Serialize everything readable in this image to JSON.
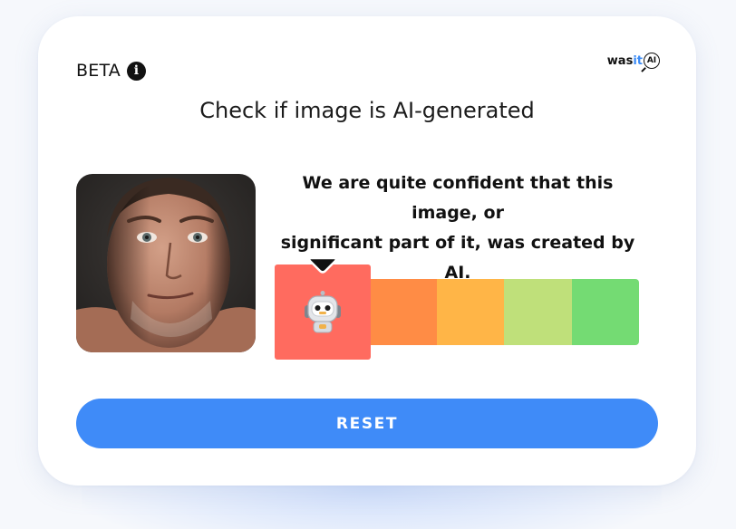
{
  "header": {
    "beta_label": "BETA",
    "info_icon": "info-icon",
    "logo": {
      "prefix": "was",
      "highlight": "it",
      "badge": "AI"
    }
  },
  "title": "Check if image is AI-generated",
  "result": {
    "verdict_line1": "We are quite confident that this image, or",
    "verdict_line2": "significant part of it, was created by AI.",
    "scale_segments": 5,
    "selected_segment": 1,
    "selected_icon": "robot-icon",
    "colors": [
      "#ff6b5f",
      "#ff8c45",
      "#ffb547",
      "#bfe07a",
      "#74db73"
    ]
  },
  "reset_label": "RESET",
  "accent_color": "#3f8bf8"
}
